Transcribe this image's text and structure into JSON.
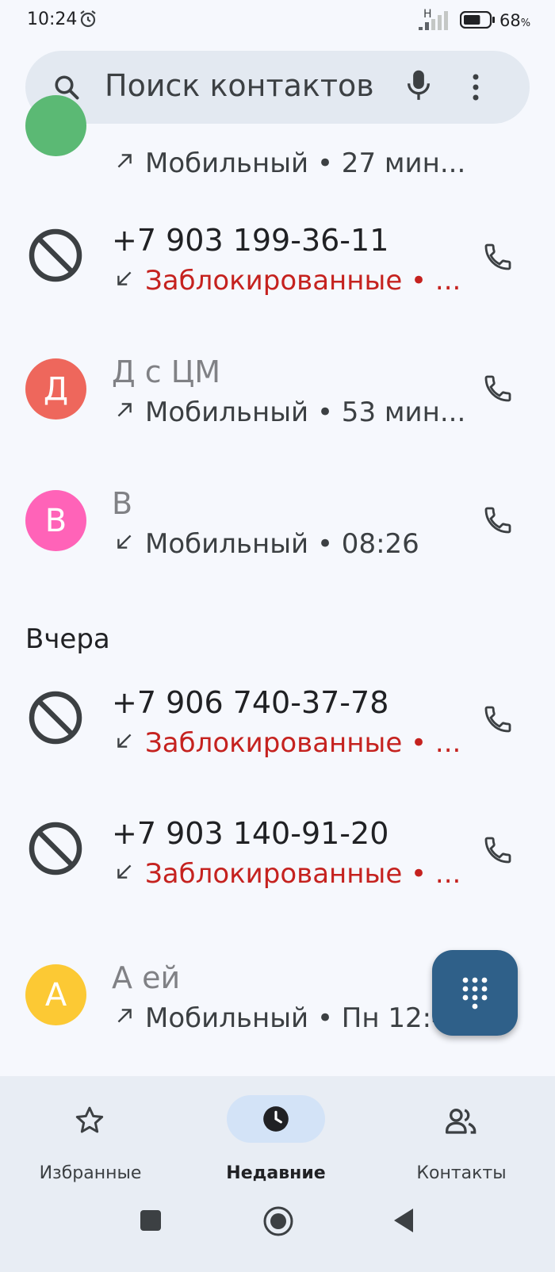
{
  "status_bar": {
    "time": "10:24",
    "network_type": "H",
    "battery_percent": "68",
    "battery_unit": "%",
    "battery_level": 0.68
  },
  "search": {
    "placeholder": "Поиск контактов"
  },
  "calls": [
    {
      "avatar_letter": "",
      "avatar_color": "#5bb974",
      "name": "",
      "direction": "outgoing",
      "detail": "Мобильный • 27 мин...",
      "blocked": false
    },
    {
      "avatar_letter": "",
      "avatar_color": "",
      "name": "+7 903 199-36-11",
      "direction": "incoming",
      "detail": "Заблокированные • ...",
      "blocked": true
    },
    {
      "avatar_letter": "Д",
      "avatar_color": "#ee675c",
      "name": "Д    с ЦМ",
      "direction": "outgoing",
      "detail": "Мобильный • 53 мин...",
      "blocked": false
    },
    {
      "avatar_letter": "В",
      "avatar_color": "#ff63b8",
      "name": "В",
      "direction": "incoming",
      "detail": "Мобильный • 08:26",
      "blocked": false
    },
    {
      "avatar_letter": "",
      "avatar_color": "",
      "name": "+7 906 740-37-78",
      "direction": "incoming",
      "detail": "Заблокированные • ...",
      "blocked": true
    },
    {
      "avatar_letter": "",
      "avatar_color": "",
      "name": "+7 903 140-91-20",
      "direction": "incoming",
      "detail": "Заблокированные • ...",
      "blocked": true
    },
    {
      "avatar_letter": "А",
      "avatar_color": "#fcc934",
      "name": "А    ей",
      "direction": "outgoing",
      "detail": "Мобильный • Пн 12:41",
      "blocked": false
    }
  ],
  "section": {
    "yesterday": "Вчера"
  },
  "nav": {
    "favorites": "Избранные",
    "recent": "Недавние",
    "contacts": "Контакты"
  },
  "colors": {
    "accent": "#2f6089",
    "blocked_text": "#c5221f",
    "active_pill": "#d3e3f7"
  }
}
